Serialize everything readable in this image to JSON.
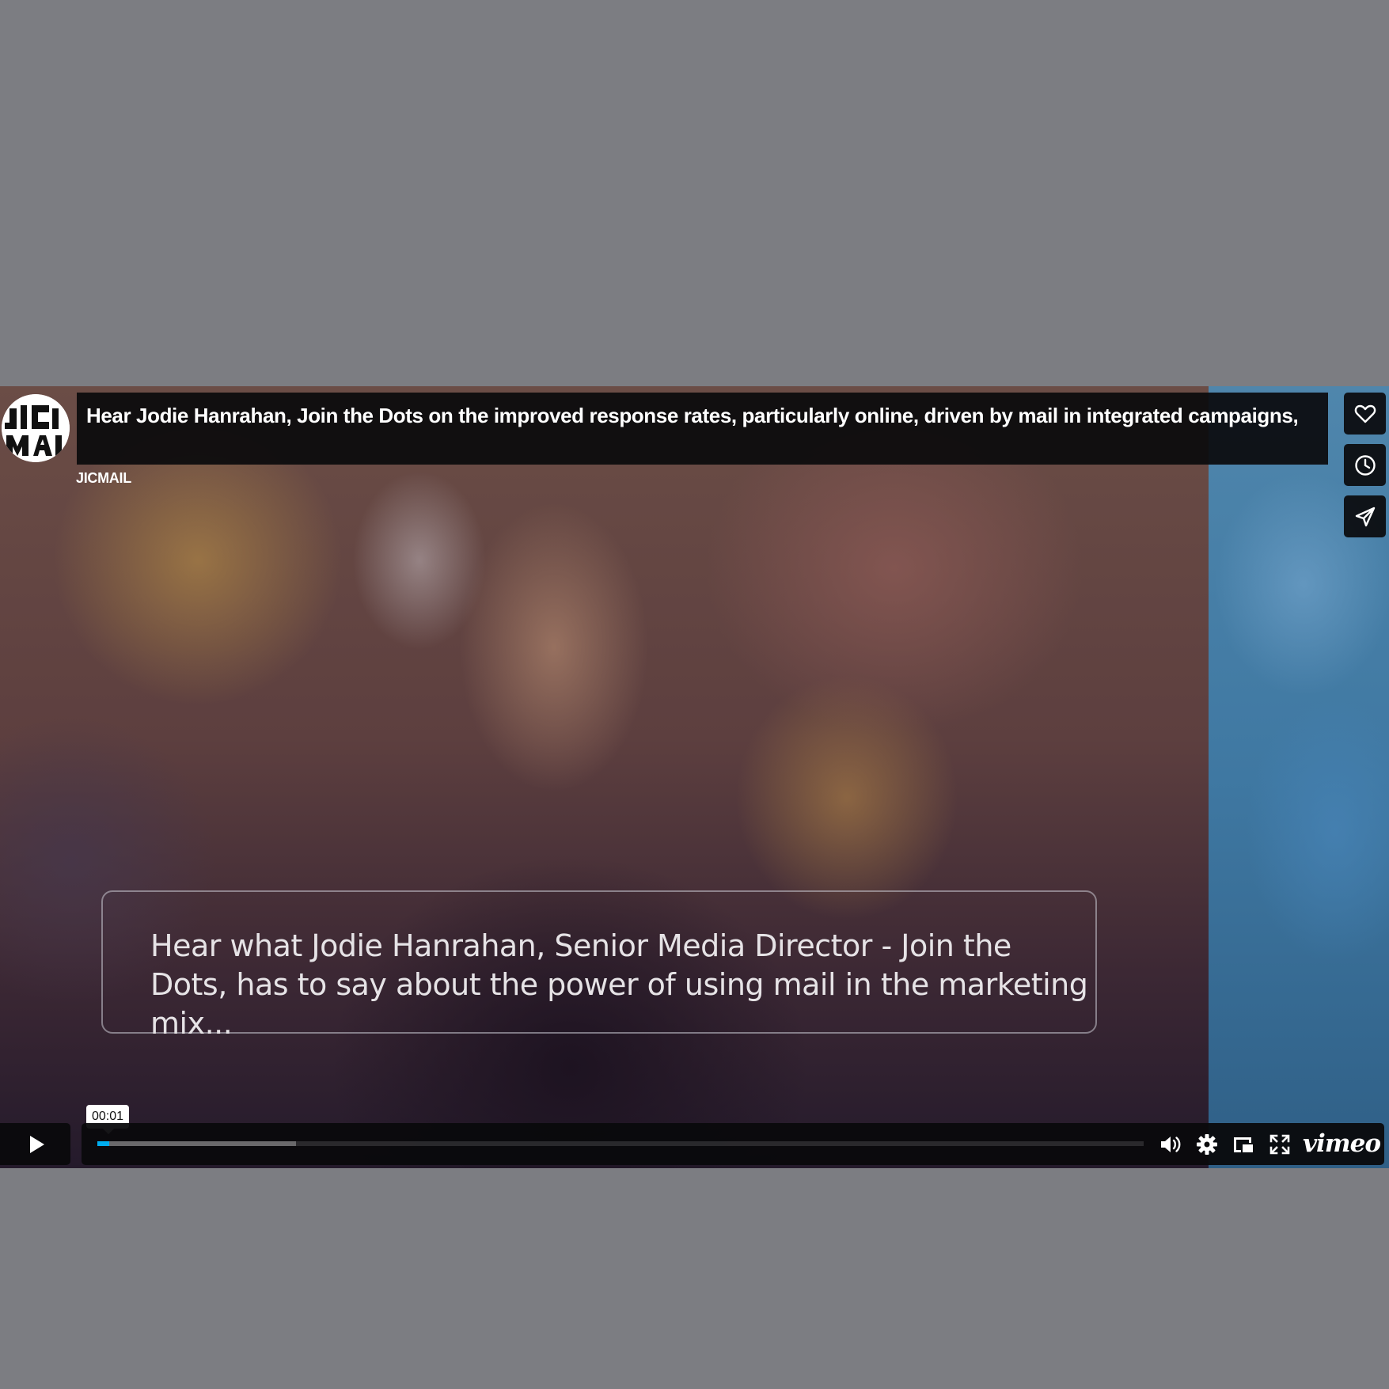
{
  "video": {
    "title": "Hear Jodie Hanrahan, Join the Dots on the improved response rates, particularly online, driven by mail in integrated campaigns,",
    "byline": "JICMAIL",
    "caption": "Hear what Jodie Hanrahan, Senior Media Director - Join the Dots, has to say about the power of using mail in the marketing mix...",
    "logo_text": "JICMAIL"
  },
  "side_buttons": [
    {
      "name": "like",
      "icon": "heart-icon"
    },
    {
      "name": "watch-later",
      "icon": "clock-icon"
    },
    {
      "name": "share",
      "icon": "send-icon"
    }
  ],
  "controls": {
    "current_time": "00:01",
    "played_percent": 1.1,
    "buffered_percent": 19,
    "brand": "vimeo",
    "icons": [
      "play-icon",
      "volume-icon",
      "gear-icon",
      "pip-icon",
      "fullscreen-icon"
    ]
  },
  "colors": {
    "page_background": "#7c7d82",
    "control_background": "#0a0a0c",
    "progress_accent": "#00adef"
  }
}
